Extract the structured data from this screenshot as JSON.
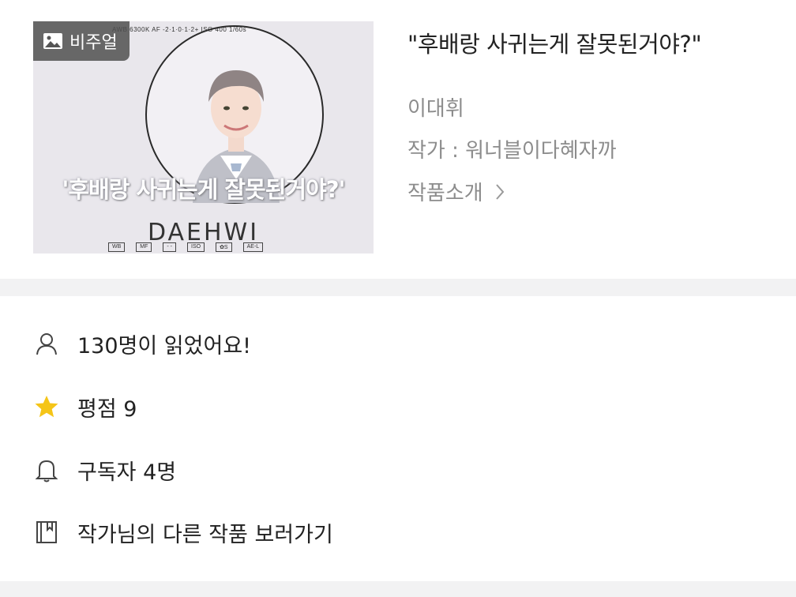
{
  "work": {
    "badge_label": "비주얼",
    "title": "\"후배랑 사귀는게 잘못된거야?\"",
    "member": "이대휘",
    "writer": "작가 : 워너블이다혜자까",
    "intro_label": "작품소개"
  },
  "cover": {
    "hud_top": "AWB 6300K    AF    -2·1·0·1·2+    ISO 400    1/60s",
    "caption": "'후배랑 사귀는게 잘못된거야?'",
    "name": "DAEHWI",
    "hud_bottom": [
      "WB",
      "MF",
      "- -",
      "ISO",
      "✿S",
      "AE-L"
    ]
  },
  "stats": {
    "readers": "130명이 읽었어요!",
    "rating": "평점 9",
    "subscribers": "구독자 4명",
    "other_works": "작가님의 다른 작품 보러가기"
  },
  "icons": {
    "badge": "image-icon",
    "intro": "chevron-right-icon",
    "readers": "person-icon",
    "rating": "star-icon",
    "subscribers": "bell-icon",
    "other_works": "book-icon"
  },
  "colors": {
    "star": "#f5c518",
    "muted_text": "#8c8c8c",
    "divider": "#f2f2f3"
  }
}
